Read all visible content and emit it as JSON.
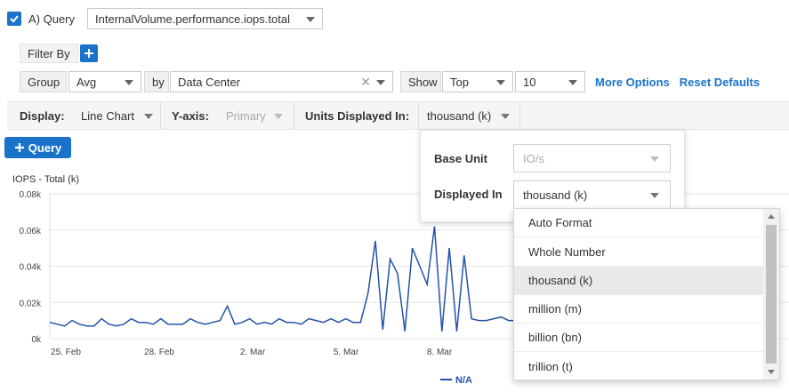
{
  "query": {
    "checked": true,
    "label": "A) Query",
    "metric": "InternalVolume.performance.iops.total"
  },
  "filter": {
    "label": "Filter By"
  },
  "group": {
    "label": "Group",
    "aggregation": "Avg",
    "by_label": "by",
    "by_value": "Data Center",
    "show_label": "Show",
    "show_value": "Top",
    "count": "10",
    "more_options": "More Options",
    "reset_defaults": "Reset Defaults"
  },
  "display_bar": {
    "display_label": "Display:",
    "display_value": "Line Chart",
    "yaxis_label": "Y-axis:",
    "yaxis_value": "Primary",
    "units_label": "Units Displayed In:",
    "units_value": "thousand (k)"
  },
  "add_query_button": "Query",
  "units_popover": {
    "base_unit_label": "Base Unit",
    "base_unit_value": "IO/s",
    "displayed_in_label": "Displayed In",
    "displayed_in_value": "thousand (k)"
  },
  "units_dropdown": {
    "options": [
      "Auto Format",
      "Whole Number",
      "thousand (k)",
      "million (m)",
      "billion (bn)",
      "trillion (t)"
    ],
    "highlighted": "thousand (k)"
  },
  "colors": {
    "accent": "#1a73c9",
    "line": "#2352a8"
  },
  "chart_data": {
    "type": "line",
    "title": "IOPS - Total (k)",
    "xlabel": "",
    "ylabel": "",
    "ylim": [
      0,
      0.08
    ],
    "y_ticks": [
      "0k",
      "0.02k",
      "0.04k",
      "0.06k",
      "0.08k"
    ],
    "x_ticks": [
      "25. Feb",
      "28. Feb",
      "2. Mar",
      "5. Mar",
      "8. Mar"
    ],
    "grid": true,
    "legend_position": "bottom-center",
    "series": [
      {
        "name": "N/A",
        "values": [
          0.009,
          0.008,
          0.007,
          0.01,
          0.008,
          0.007,
          0.007,
          0.011,
          0.008,
          0.007,
          0.008,
          0.011,
          0.009,
          0.009,
          0.008,
          0.011,
          0.008,
          0.008,
          0.008,
          0.011,
          0.009,
          0.008,
          0.009,
          0.01,
          0.018,
          0.008,
          0.009,
          0.011,
          0.008,
          0.009,
          0.008,
          0.011,
          0.009,
          0.009,
          0.008,
          0.011,
          0.01,
          0.009,
          0.011,
          0.009,
          0.011,
          0.009,
          0.009,
          0.025,
          0.054,
          0.005,
          0.044,
          0.036,
          0.004,
          0.05,
          0.04,
          0.03,
          0.062,
          0.004,
          0.05,
          0.004,
          0.046,
          0.011,
          0.01,
          0.01,
          0.011,
          0.012,
          0.01,
          0.01
        ]
      }
    ]
  }
}
